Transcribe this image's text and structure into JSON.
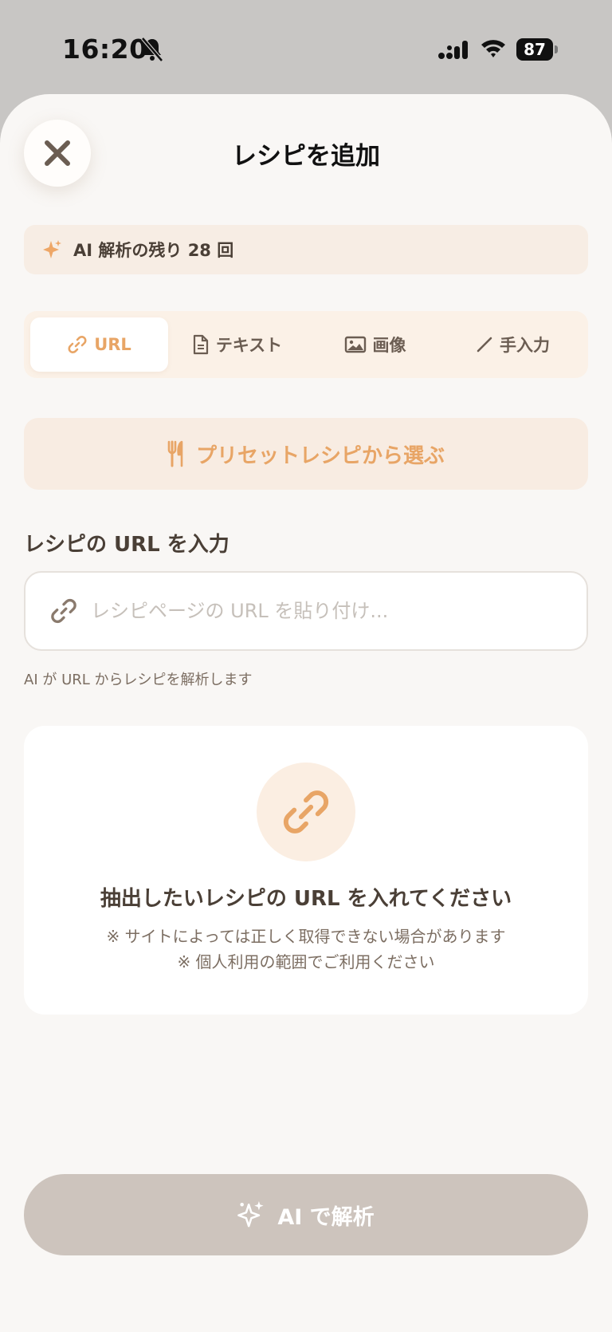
{
  "status_bar": {
    "time": "16:20",
    "battery": "87",
    "icons": [
      "bell-slash-icon",
      "signal-icon",
      "wifi-icon",
      "battery-icon"
    ]
  },
  "header": {
    "title": "レシピを追加",
    "close_icon": "close-icon"
  },
  "ai_banner": {
    "icon": "sparkle-icon",
    "text": "AI 解析の残り 28 回"
  },
  "tabs": [
    {
      "label": "URL",
      "icon": "link-icon",
      "active": true
    },
    {
      "label": "テキスト",
      "icon": "document-icon",
      "active": false
    },
    {
      "label": "画像",
      "icon": "image-icon",
      "active": false
    },
    {
      "label": "手入力",
      "icon": "pencil-icon",
      "active": false
    }
  ],
  "preset_button": {
    "icon": "utensils-icon",
    "label": "プリセットレシピから選ぶ"
  },
  "url_section": {
    "label": "レシピの URL を入力",
    "placeholder": "レシピページの URL を貼り付け...",
    "value": "",
    "helper": "AI が URL からレシピを解析します"
  },
  "empty_state": {
    "icon": "link-icon",
    "title": "抽出したいレシピの URL を入れてください",
    "notes": [
      "※ サイトによっては正しく取得できない場合があります",
      "※ 個人利用の範囲でご利用ください"
    ]
  },
  "analyze_button": {
    "icon": "sparkle-icon",
    "label": "AI で解析"
  },
  "colors": {
    "accent": "#e8a566",
    "text": "#4a3f36",
    "sheet_bg": "#f9f7f5",
    "disabled_button": "#cdc4bd"
  }
}
